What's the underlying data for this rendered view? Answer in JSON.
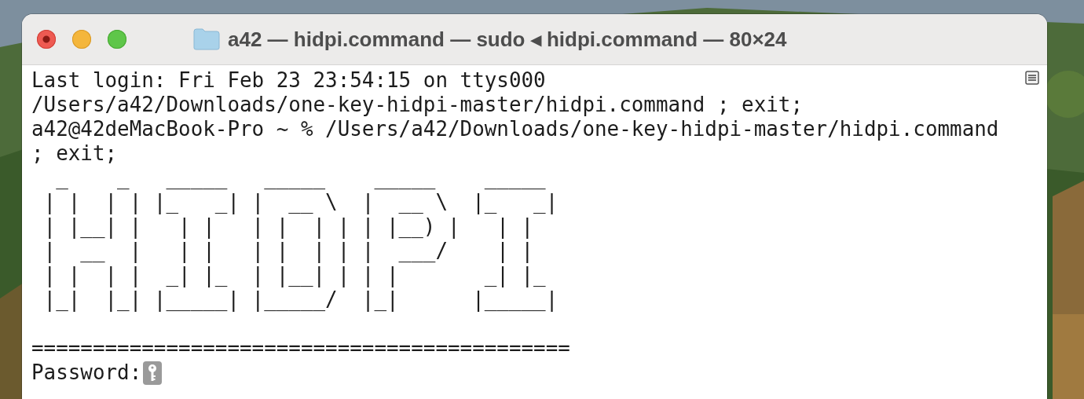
{
  "window": {
    "title": "a42 — hidpi.command — sudo ◂ hidpi.command — 80×24"
  },
  "terminal": {
    "lines": [
      "Last login: Fri Feb 23 23:54:15 on ttys000",
      "/Users/a42/Downloads/one-key-hidpi-master/hidpi.command ; exit;",
      "a42@42deMacBook-Pro ~ % /Users/a42/Downloads/one-key-hidpi-master/hidpi.command",
      "; exit;"
    ],
    "banner": [
      "  _    _   _____   _____    _____    _____",
      " | |  | | |_   _| |  __ \\  |  __ \\  |_   _|",
      " | |__| |   | |   | |  | | | |__) |   | |",
      " |  __  |   | |   | |  | | |  ___/    | |",
      " | |  | |  _| |_  | |__| | | |       _| |_",
      " |_|  |_| |_____| |_____/  |_|      |_____|"
    ],
    "rule": "============================================",
    "prompt": "Password:"
  }
}
